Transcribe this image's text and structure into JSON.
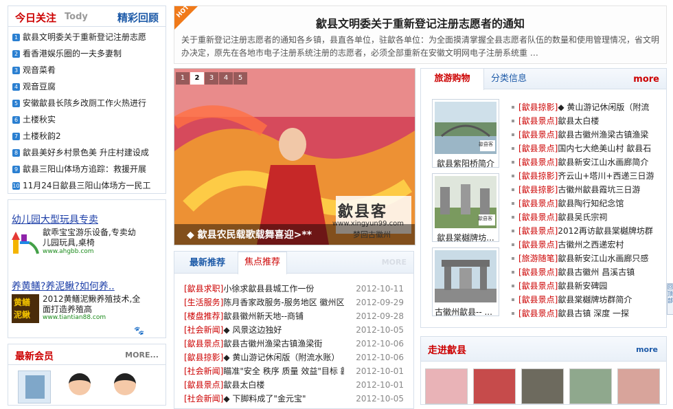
{
  "left": {
    "title": "今日关注",
    "sub": "Tody",
    "more": "精彩回顾",
    "items": [
      "歙县文明委关于重新登记注册志愿",
      "看香港娱乐圈的一夫多妻制",
      "观音菜肴",
      "观音豆腐",
      "安徽歙县长陔乡改厕工作火热进行",
      "土楼秋实",
      "土楼秋韵2",
      "歙县美好乡村景色美 升庄村建设成",
      "歙县三阳山体场方追踪：救援开展",
      "11月24日歙县三阳山体场方一民工"
    ],
    "ads": [
      {
        "title": "幼儿园大型玩具专卖",
        "desc": "歙乖宝宝游乐设备,专卖幼儿园玩具,桌椅",
        "url": "www.ahgbb.com"
      },
      {
        "title": "养黄鳝?养泥鳅?如何养..",
        "desc": "2012黄鳝泥鳅养殖技术,全面打造养殖高",
        "url": "www.tiantian88.com",
        "logo": "黄鳝 泥鳅"
      }
    ],
    "members_title": "最新会员",
    "members_more": "MORE..."
  },
  "notice": {
    "badge": "HOT",
    "title": "歙县文明委关于重新登记注册志愿者的通知",
    "body": "关于重新登记注册志愿者的通知各乡镇，县直各单位，驻歙各单位：为全面摸清掌握全县志愿者队伍的数量和使用管理情况，省文明办决定，原先在各地市电子注册系统注册的志愿者，必须全部重新在安徽文明网电子注册系统重 …"
  },
  "slider": {
    "pages": [
      "1",
      "2",
      "3",
      "4",
      "5"
    ],
    "active": "2",
    "caption": "◆ 歙县农民载歌载舞喜迎>**",
    "watermark": "歙县客",
    "watermark_url": "www.xingyun99.com",
    "watermark_sub": "梦回古徽州"
  },
  "news": {
    "tabs": [
      "最新推荐",
      "焦点推荐"
    ],
    "more": "MORE",
    "rows": [
      {
        "cat": "[歙县求职]",
        "title": "小徐求歙县县城工作一份",
        "date": "2012-10-11"
      },
      {
        "cat": "[生活服务]",
        "title": "陈月香家政服务-服务地区 徽州区",
        "date": "2012-09-29"
      },
      {
        "cat": "[楼盘推荐]",
        "title": "歙县徽州新天地--商铺",
        "date": "2012-09-28"
      },
      {
        "cat": "[社会新闻]",
        "title": "◆ 风景这边独好",
        "date": "2012-10-05"
      },
      {
        "cat": "[歙县景点]",
        "title": "歙县古徽州渔梁古镇渔梁街",
        "date": "2012-10-06"
      },
      {
        "cat": "[歙县掠影]",
        "title": "◆ 黄山游记休闲版（附流水账）",
        "date": "2012-10-06"
      },
      {
        "cat": "[社会新闻]",
        "title": "瞄准\"安全 秩序 质量 效益\"目标 歙",
        "date": "2012-10-01"
      },
      {
        "cat": "[歙县景点]",
        "title": "歙县太白楼",
        "date": "2012-10-01"
      },
      {
        "cat": "[社会新闻]",
        "title": "◆ 下脚料成了\"金元宝\"",
        "date": "2012-10-05"
      }
    ]
  },
  "travel": {
    "tabs": [
      "旅游购物",
      "分类信息"
    ],
    "more": "more",
    "thumbs": [
      "歙县紫阳桥简介",
      "歙县棠樾牌坊...",
      "古徽州歙县-- ..."
    ],
    "thumb_stamp": "歙县客",
    "items": [
      {
        "cat": "[歙县掠影]",
        "title": "◆ 黄山游记休闲版（附流"
      },
      {
        "cat": "[歙县景点]",
        "title": "歙县太白楼"
      },
      {
        "cat": "[歙县景点]",
        "title": "歙县古徽州渔梁古镇渔梁"
      },
      {
        "cat": "[歙县景点]",
        "title": "国内七大绝美山村 歙县石"
      },
      {
        "cat": "[歙县景点]",
        "title": "歙县新安江山水画廊简介"
      },
      {
        "cat": "[歙县掠影]",
        "title": "齐云山+塔川+西递三日游"
      },
      {
        "cat": "[歙县掠影]",
        "title": "古徽州歙县霞坑三日游"
      },
      {
        "cat": "[歙县景点]",
        "title": "歙县陶行知纪念馆"
      },
      {
        "cat": "[歙县景点]",
        "title": "歙县吴氏宗祠"
      },
      {
        "cat": "[歙县景点]",
        "title": "2012再访歙县棠樾牌坊群"
      },
      {
        "cat": "[歙县景点]",
        "title": "古徽州之西递宏村"
      },
      {
        "cat": "[旅游随笔]",
        "title": "歙县新安江山水画廊只感"
      },
      {
        "cat": "[歙县景点]",
        "title": "歙县古徽州 昌溪古镇"
      },
      {
        "cat": "[歙县景点]",
        "title": "歙县新安碑园"
      },
      {
        "cat": "[歙县景点]",
        "title": "歙县棠樾牌坊群简介"
      },
      {
        "cat": "[歙县景点]",
        "title": "歙县古镇 深度 一探"
      }
    ]
  },
  "enter": {
    "title": "走进歙县",
    "more": "more"
  },
  "side_tab": "回顶部"
}
